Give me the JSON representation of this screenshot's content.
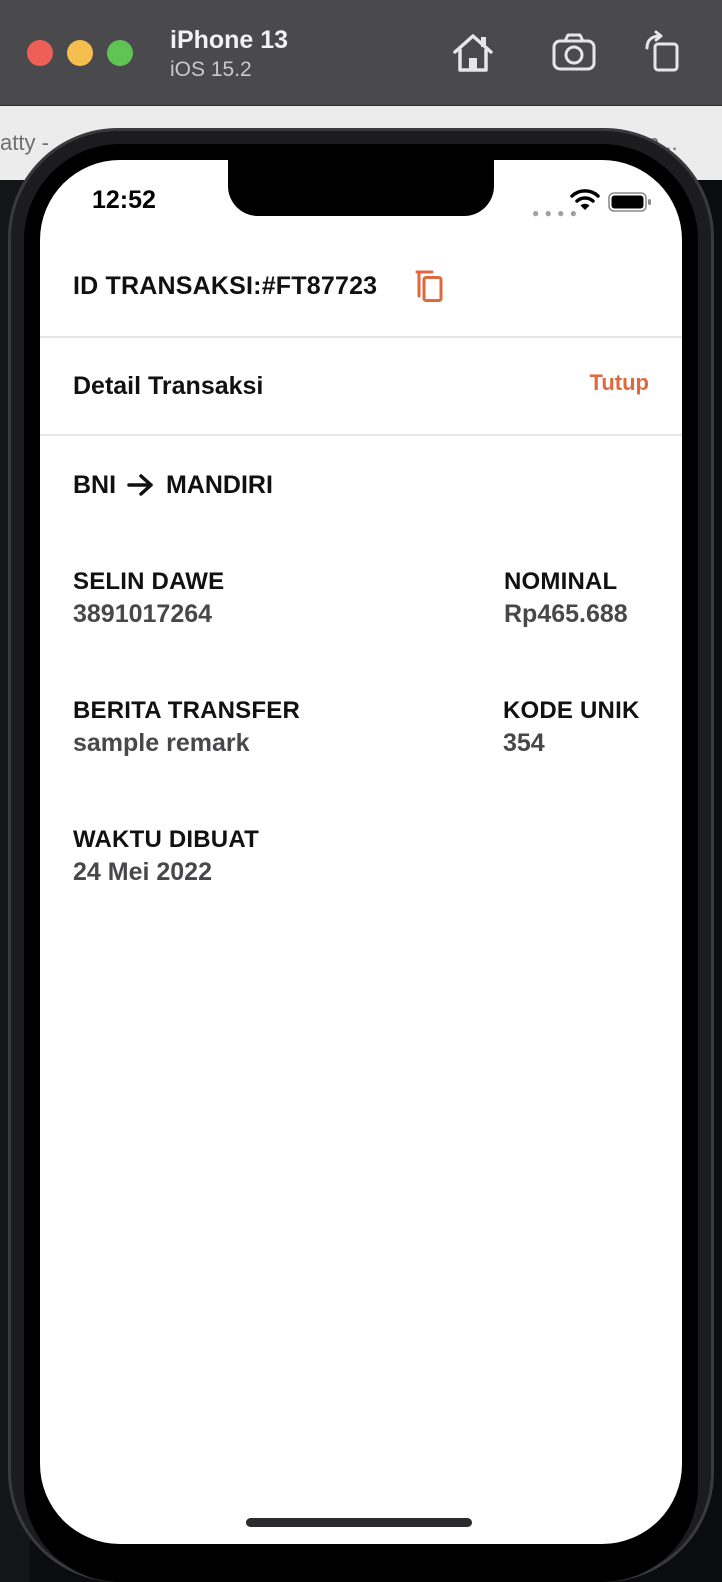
{
  "simulator": {
    "device_name": "iPhone 13",
    "os_version": "iOS 15.2",
    "behind_text_left": "atty -",
    "behind_text_right": "n..."
  },
  "status_bar": {
    "time": "12:52"
  },
  "transaction": {
    "id_label": "ID TRANSAKSI:#FT87723",
    "detail_title": "Detail Transaksi",
    "close_label": "Tutup",
    "route_from": "BNI",
    "route_to": "MANDIRI",
    "account_name": "SELIN DAWE",
    "account_number": "3891017264",
    "nominal_label": "NOMINAL",
    "nominal_value": "Rp465.688",
    "remark_label": "BERITA TRANSFER",
    "remark_value": "sample remark",
    "unique_code_label": "KODE UNIK",
    "unique_code_value": "354",
    "created_label": "WAKTU DIBUAT",
    "created_value": "24 Mei 2022"
  },
  "colors": {
    "accent": "#e0683e",
    "title_bar": "#4a494c"
  },
  "icons": [
    "home-icon",
    "camera-icon",
    "rotate-icon",
    "wifi-icon",
    "battery-icon",
    "copy-icon",
    "arrow-right-icon"
  ]
}
